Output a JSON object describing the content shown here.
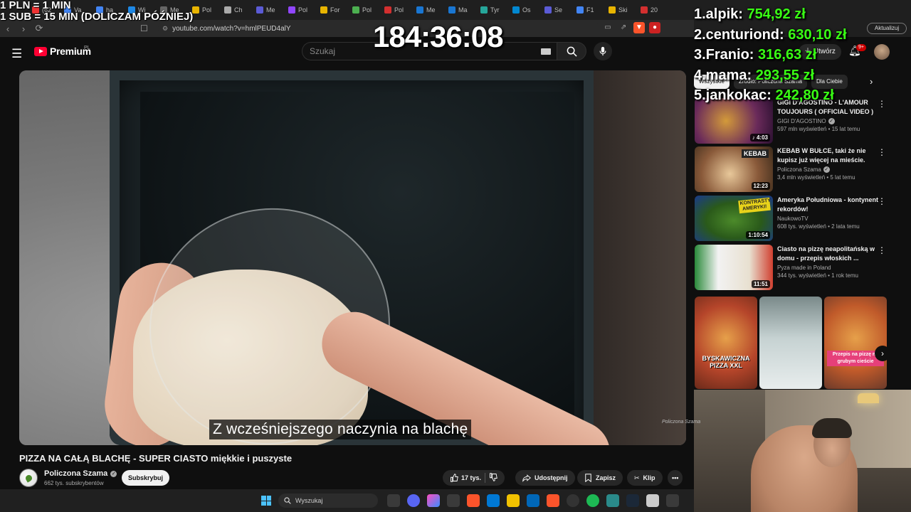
{
  "overlay": {
    "rate_line_1": "1 PLN = 1 MIN",
    "rate_line_2": "1 SUB = 15 MIN (DOLICZAM PÓŹNIEJ)",
    "timer": "184:36:08"
  },
  "leaderboard": [
    {
      "name": "1.alpik: ",
      "amount": "754,92 zł"
    },
    {
      "name": "2.centuriond: ",
      "amount": "630,10 zł"
    },
    {
      "name": "3.Franio: ",
      "amount": "316,63 zł"
    },
    {
      "name": "4.mama: ",
      "amount": "293,55 zł"
    },
    {
      "name": "5.jankokac: ",
      "amount": "242,80 zł"
    }
  ],
  "browser": {
    "url": "youtube.com/watch?v=hmlPEUD4alY",
    "tabs": [
      "(62",
      "Va",
      "ha",
      "Wi",
      "Me",
      "Pol",
      "Ch",
      "Me",
      "Pol",
      "For",
      "Pol",
      "Pol",
      "Me",
      "Ma",
      "Tyr",
      "Os",
      "Se",
      "F1",
      "Ski",
      "20"
    ],
    "update_label": "Aktualizuj"
  },
  "youtube": {
    "logo_word": "Premium",
    "region": "PL",
    "search_placeholder": "Szukaj",
    "create_label": "Utwórz",
    "notif_count": "9+"
  },
  "video": {
    "caption": "Z wcześniejszego naczynia na blachę",
    "watermark": "Policzona Szama",
    "title": "PIZZA NA CAŁĄ BLACHĘ - SUPER CIASTO miękkie i puszyste",
    "channel_name": "Policzona Szama",
    "subscribers": "662 tys. subskrybentów",
    "subscribe_label": "Subskrybuj",
    "likes": "17 tys.",
    "share_label": "Udostępnij",
    "save_label": "Zapisz",
    "clip_label": "Klip"
  },
  "sidebar": {
    "chips": [
      "Wszystkie",
      "Źródło: Policzona Szama",
      "Dla Ciebie"
    ],
    "recommendations": [
      {
        "title": "GIGI D'AGOSTINO - L'AMOUR TOUJOURS ( OFFICIAL VIDEO )",
        "channel": "GIGI D'AGOSTINO",
        "stats": "597 mln wyświetleń • 15 lat temu",
        "duration": "4:03"
      },
      {
        "title": "KEBAB W BUŁCE, taki że nie kupisz już więcej na mieście.",
        "channel": "Policzona Szama",
        "stats": "3,4 mln wyświetleń • 5 lat temu",
        "duration": "12:23",
        "thumb_label": "KEBAB"
      },
      {
        "title": "Ameryka Południowa - kontynent rekordów!",
        "channel": "NaukowoTV",
        "stats": "608 tys. wyświetleń • 2 lata temu",
        "duration": "1:10:54",
        "thumb_label": "KONTRASTY AMERYKI!"
      },
      {
        "title": "Ciasto na pizzę neapolitańską w domu - przepis włoskich ...",
        "channel": "Pyza made in Poland",
        "stats": "344 tys. wyświetleń • 1 rok temu",
        "duration": "11:51"
      }
    ],
    "shorts": [
      {
        "label": "BYSKAWICZNA PIZZA XXL"
      },
      {
        "label": ""
      },
      {
        "label": "Przepis na pizzę na grubym cieście"
      }
    ]
  },
  "taskbar": {
    "search_placeholder": "Wyszukaj"
  },
  "colors": {
    "accent_red": "#ff0033",
    "leaderboard_amount": "#39ff14",
    "background": "#0f0f0f"
  }
}
